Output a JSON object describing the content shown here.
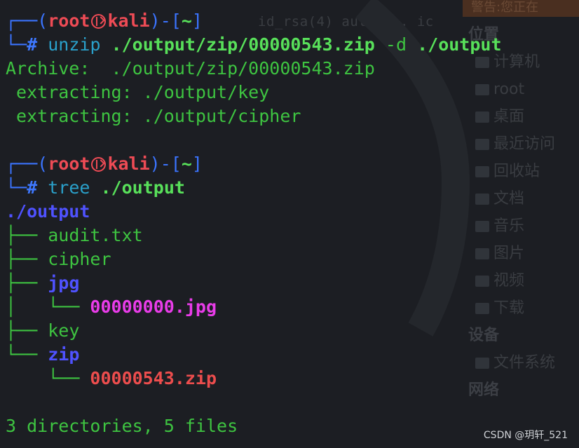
{
  "background": {
    "tabs_text": "id_rsa(4)   autor...   ic",
    "banner_text": "警告:您正在",
    "sidebar": [
      {
        "type": "section",
        "label": "位置"
      },
      {
        "type": "item",
        "label": "计算机"
      },
      {
        "type": "item",
        "label": "root"
      },
      {
        "type": "item",
        "label": "桌面"
      },
      {
        "type": "item",
        "label": "最近访问"
      },
      {
        "type": "item",
        "label": "回收站"
      },
      {
        "type": "item",
        "label": "文档"
      },
      {
        "type": "item",
        "label": "音乐"
      },
      {
        "type": "item",
        "label": "图片"
      },
      {
        "type": "item",
        "label": "视频"
      },
      {
        "type": "item",
        "label": "下载"
      },
      {
        "type": "section",
        "label": "设备"
      },
      {
        "type": "item",
        "label": "文件系统"
      },
      {
        "type": "section",
        "label": "网络"
      }
    ]
  },
  "prompt": {
    "user": "root",
    "host": "kali",
    "cwd": "~",
    "symbol": "#"
  },
  "cmd1": {
    "name": "unzip",
    "arg1": "./output/zip/00000543.zip",
    "flag": "-d",
    "arg2": "./output"
  },
  "out1": {
    "archive": "Archive:  ./output/zip/00000543.zip",
    "extract1": " extracting: ./output/key",
    "extract2": " extracting: ./output/cipher"
  },
  "cmd2": {
    "name": "tree",
    "arg1": "./output"
  },
  "tree": {
    "root": "./output",
    "items": {
      "audit": "audit.txt",
      "cipher": "cipher",
      "jpg_dir": "jpg",
      "jpg_file": "00000000.jpg",
      "key": "key",
      "zip_dir": "zip",
      "zip_file": "00000543.zip"
    },
    "summary": "3 directories, 5 files"
  },
  "watermark": "CSDN @玥轩_521",
  "colors": {
    "terminal_bg": "#1c1e23",
    "prompt_frame": "#3b74ff",
    "user_red": "#ee4b55",
    "text_green": "#3ec441",
    "command_cyan": "#2aa0ca",
    "dir_blue": "#4f52ff",
    "image_magenta": "#e93ce9",
    "archive_red": "#ec4d4d"
  }
}
